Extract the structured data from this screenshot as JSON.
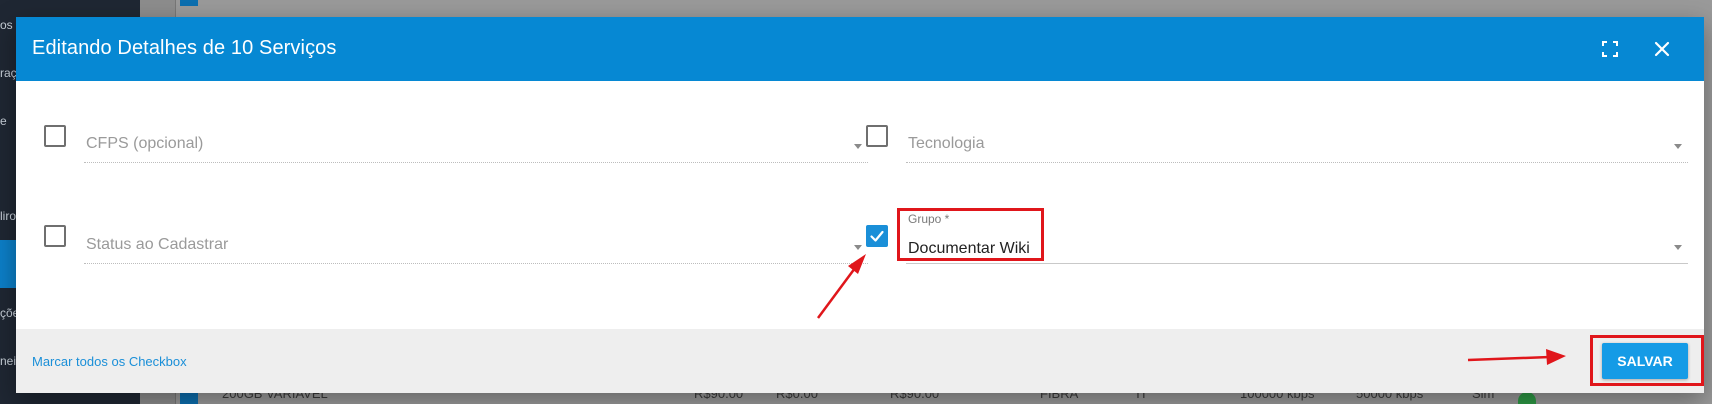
{
  "background": {
    "sidebar_fragments": [
      "os",
      "raç",
      "e",
      "liro",
      "çõe",
      "nei"
    ],
    "bottom_row": [
      "200GB VARIAVEL",
      "R$90.00",
      "R$0.00",
      "R$90.00",
      "FIBRA",
      "TI",
      "100000 kbps",
      "50000 kbps",
      "Sim"
    ]
  },
  "dialog": {
    "title": "Editando Detalhes de 10 Serviços",
    "fields": {
      "cfps": {
        "placeholder": "CFPS (opcional)",
        "checked": false
      },
      "tecnologia": {
        "placeholder": "Tecnologia",
        "checked": false
      },
      "status": {
        "placeholder": "Status ao Cadastrar",
        "checked": false
      },
      "grupo": {
        "label": "Grupo *",
        "value": "Documentar Wiki",
        "checked": true
      }
    },
    "footer": {
      "mark_all_link": "Marcar todos os Checkbox",
      "save_label": "SALVAR"
    }
  },
  "colors": {
    "header": "#0688d3",
    "accent": "#1a8fd8",
    "annotation": "#e0161b"
  },
  "icons": [
    "fullscreen-icon",
    "close-icon",
    "check-icon",
    "dropdown-arrow-icon"
  ]
}
